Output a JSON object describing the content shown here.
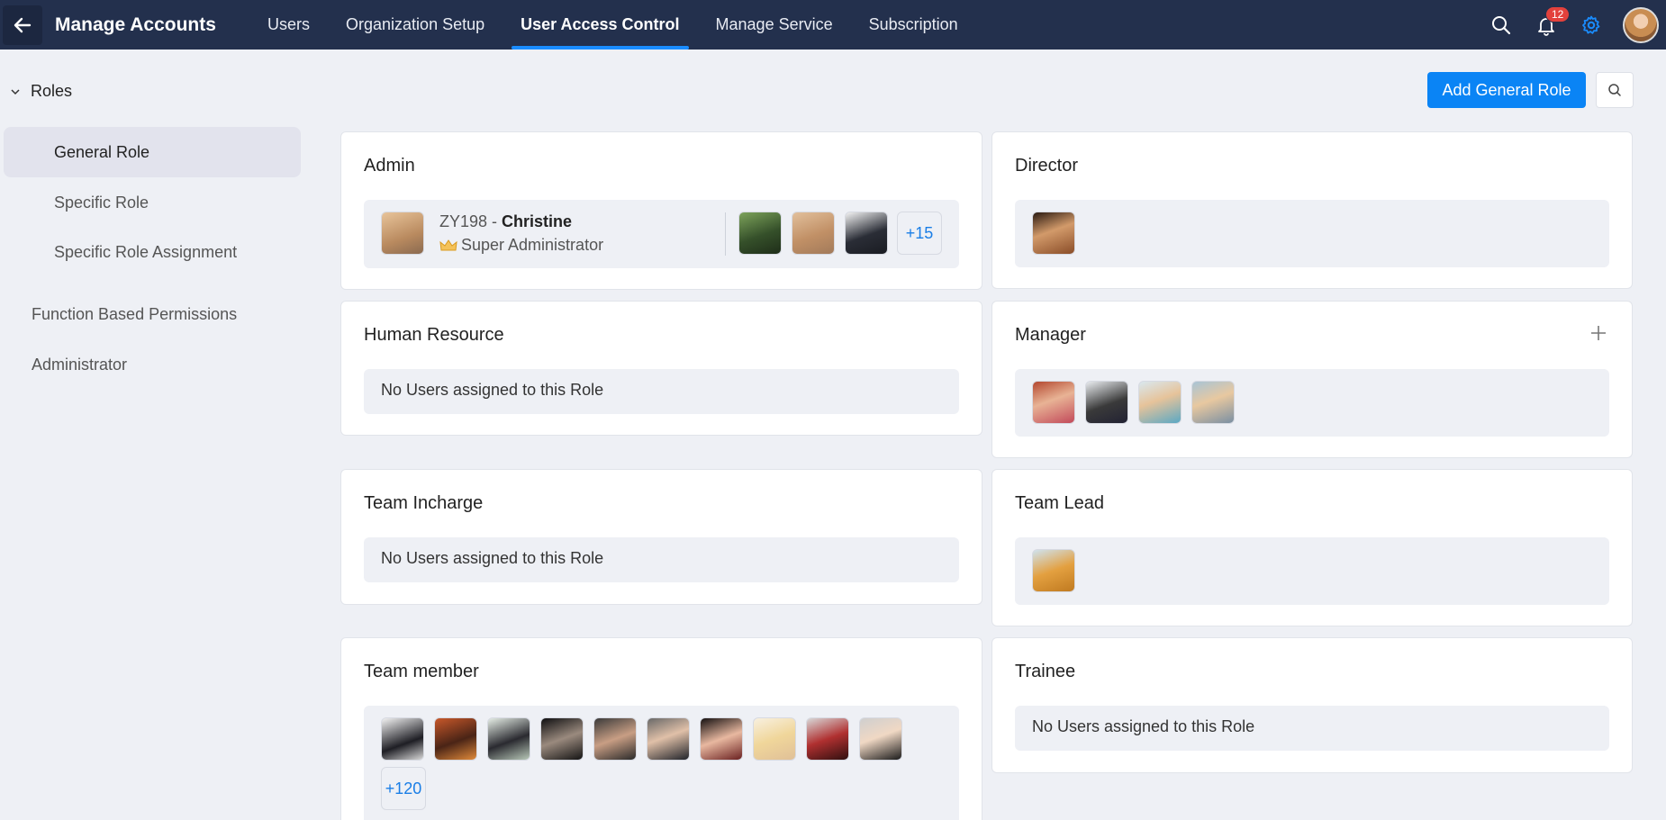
{
  "header": {
    "title": "Manage Accounts",
    "tabs": [
      {
        "label": "Users",
        "active": false
      },
      {
        "label": "Organization Setup",
        "active": false
      },
      {
        "label": "User Access Control",
        "active": true
      },
      {
        "label": "Manage Service",
        "active": false
      },
      {
        "label": "Subscription",
        "active": false
      }
    ],
    "notification_count": "12",
    "icons": [
      "back-arrow-icon",
      "search-icon",
      "bell-icon",
      "gear-icon"
    ]
  },
  "sidebar": {
    "group_label": "Roles",
    "items": [
      {
        "label": "General Role",
        "active": true
      },
      {
        "label": "Specific Role",
        "active": false
      },
      {
        "label": "Specific Role Assignment",
        "active": false
      }
    ],
    "top_items": [
      "Function Based Permissions",
      "Administrator"
    ]
  },
  "actions": {
    "add_role_label": "Add General Role"
  },
  "roles": {
    "admin": {
      "title": "Admin",
      "primary_id": "ZY198",
      "primary_sep": " - ",
      "primary_name": "Christine",
      "primary_role": "Super Administrator",
      "more": "+15"
    },
    "director": {
      "title": "Director"
    },
    "human_resource": {
      "title": "Human Resource",
      "empty": "No Users assigned to this Role"
    },
    "manager": {
      "title": "Manager"
    },
    "team_incharge": {
      "title": "Team Incharge",
      "empty": "No Users assigned to this Role"
    },
    "team_lead": {
      "title": "Team Lead"
    },
    "team_member": {
      "title": "Team member",
      "more": "+120"
    },
    "trainee": {
      "title": "Trainee",
      "empty": "No Users assigned to this Role"
    }
  },
  "colors": {
    "topbar": "#23304d",
    "accent": "#0a84f5",
    "badge": "#e3413c"
  }
}
